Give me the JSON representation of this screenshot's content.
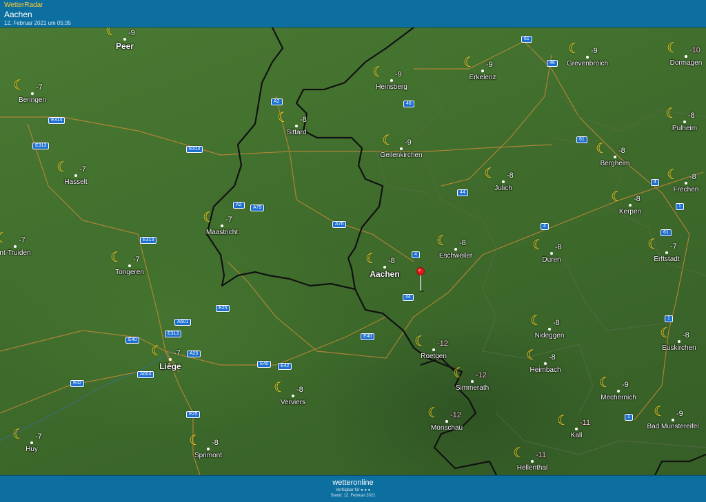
{
  "header": {
    "brand": "WetterRadar",
    "city": "Aachen",
    "date": "12. Februar 2021 um 05:35"
  },
  "footer": {
    "logo": "wetteronline",
    "available": "Verfügbar für ● ● ●",
    "stand": "Stand: 12. Februar 2021"
  },
  "colors": {
    "header_bg": "#0c6fa0",
    "brand": "#ffcc33",
    "moon": "#ffd21f",
    "road_shield": "#1d6fd0",
    "border_line": "#111111",
    "pin": "#e01818"
  },
  "locations": [
    {
      "name": "Peer",
      "temp": "-9"
    },
    {
      "name": "Beringen",
      "temp": "-7"
    },
    {
      "name": "Hasselt",
      "temp": "-7"
    },
    {
      "name": "nt-Truiden",
      "temp": "-7"
    },
    {
      "name": "Tongeren",
      "temp": "-7"
    },
    {
      "name": "Maastricht",
      "temp": "-7"
    },
    {
      "name": "Sittard",
      "temp": "-8"
    },
    {
      "name": "Heinsberg",
      "temp": "-9"
    },
    {
      "name": "Erkelenz",
      "temp": "-9"
    },
    {
      "name": "Grevenbroich",
      "temp": "-9"
    },
    {
      "name": "Dormagen",
      "temp": "-10"
    },
    {
      "name": "Geilenkirchen",
      "temp": "-9"
    },
    {
      "name": "Pulheim",
      "temp": "-8"
    },
    {
      "name": "Bergheim",
      "temp": "-8"
    },
    {
      "name": "Julich",
      "temp": "-8"
    },
    {
      "name": "Frechen",
      "temp": "-8"
    },
    {
      "name": "Kerpen",
      "temp": "-8"
    },
    {
      "name": "Eschweiler",
      "temp": "-8"
    },
    {
      "name": "Aachen",
      "temp": "-8"
    },
    {
      "name": "Duren",
      "temp": "-8"
    },
    {
      "name": "Erftstadt",
      "temp": "-7"
    },
    {
      "name": "Nideggen",
      "temp": "-8"
    },
    {
      "name": "Euskirchen",
      "temp": "-8"
    },
    {
      "name": "Liège",
      "temp": "-7"
    },
    {
      "name": "Roetgen",
      "temp": "-12"
    },
    {
      "name": "Heimbach",
      "temp": "-8"
    },
    {
      "name": "Verviers",
      "temp": "-8"
    },
    {
      "name": "Simmerath",
      "temp": "-12"
    },
    {
      "name": "Mechernich",
      "temp": "-9"
    },
    {
      "name": "Monschau",
      "temp": "-12"
    },
    {
      "name": "Kall",
      "temp": "-11"
    },
    {
      "name": "Bad Munstereifel",
      "temp": "-9"
    },
    {
      "name": "Huy",
      "temp": "-7"
    },
    {
      "name": "Sprimont",
      "temp": "-8"
    },
    {
      "name": "Hellenthal",
      "temp": "-11"
    }
  ],
  "roads": [
    "61",
    "46",
    "A2",
    "E314",
    "46",
    "E313",
    "E314",
    "61",
    "4",
    "A2",
    "A79",
    "44",
    "1",
    "E313",
    "A76",
    "61",
    "4",
    "4",
    "44",
    "E25",
    "A601",
    "E313",
    "E40",
    "A25",
    "E40",
    "E40",
    "E42",
    "1",
    "A604",
    "E42",
    "E25",
    "1"
  ]
}
